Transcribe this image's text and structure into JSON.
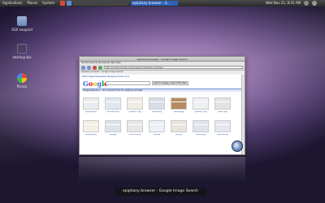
{
  "panel": {
    "menus": [
      "Applications",
      "Places",
      "System"
    ],
    "tasks": [
      "",
      "epiphany browser - G..."
    ],
    "clock": "Wed Nov 21, 8:41 AM"
  },
  "desktop_icons": [
    {
      "label": "OSX Leopard",
      "icon": "folder-icon"
    },
    {
      "label": "desktop bin",
      "icon": "file-icon"
    },
    {
      "label": "Picasa",
      "icon": "picasa-icon"
    }
  ],
  "browser": {
    "title": "epiphany browser - Google Image Search",
    "menubar": "File  Edit  View  Go  Bookmarks  Tabs  Help",
    "url": "http://images.google.com/images?q=epiphany+browser",
    "tab": "epiphany browser - Google Image Search",
    "google": {
      "logo": "Google",
      "top_links": "Web  Images  Maps  News  Shopping  Gmail  more",
      "search_button": "Search Images",
      "web_button": "Search the Web",
      "results_bar": "Images  Results 1 - 20 of about 8,710 for epiphany browser"
    },
    "thumb_labels": [
      "epiphany.png",
      "screenshot.png",
      "epiphany-1.jpg",
      "browser.png",
      "epiphany.jpg",
      "epiphany-2.jpg",
      "gnome.png",
      "epiphany.png",
      "ephy.jpg",
      "browser-ff.png",
      "web.png",
      "epi.png",
      "mockup.png",
      "epiphany.png"
    ]
  },
  "caption": "epiphany browser - Google Image Search",
  "colors": {
    "panel": "#2f2f2f",
    "accent": "#2f62b8"
  }
}
